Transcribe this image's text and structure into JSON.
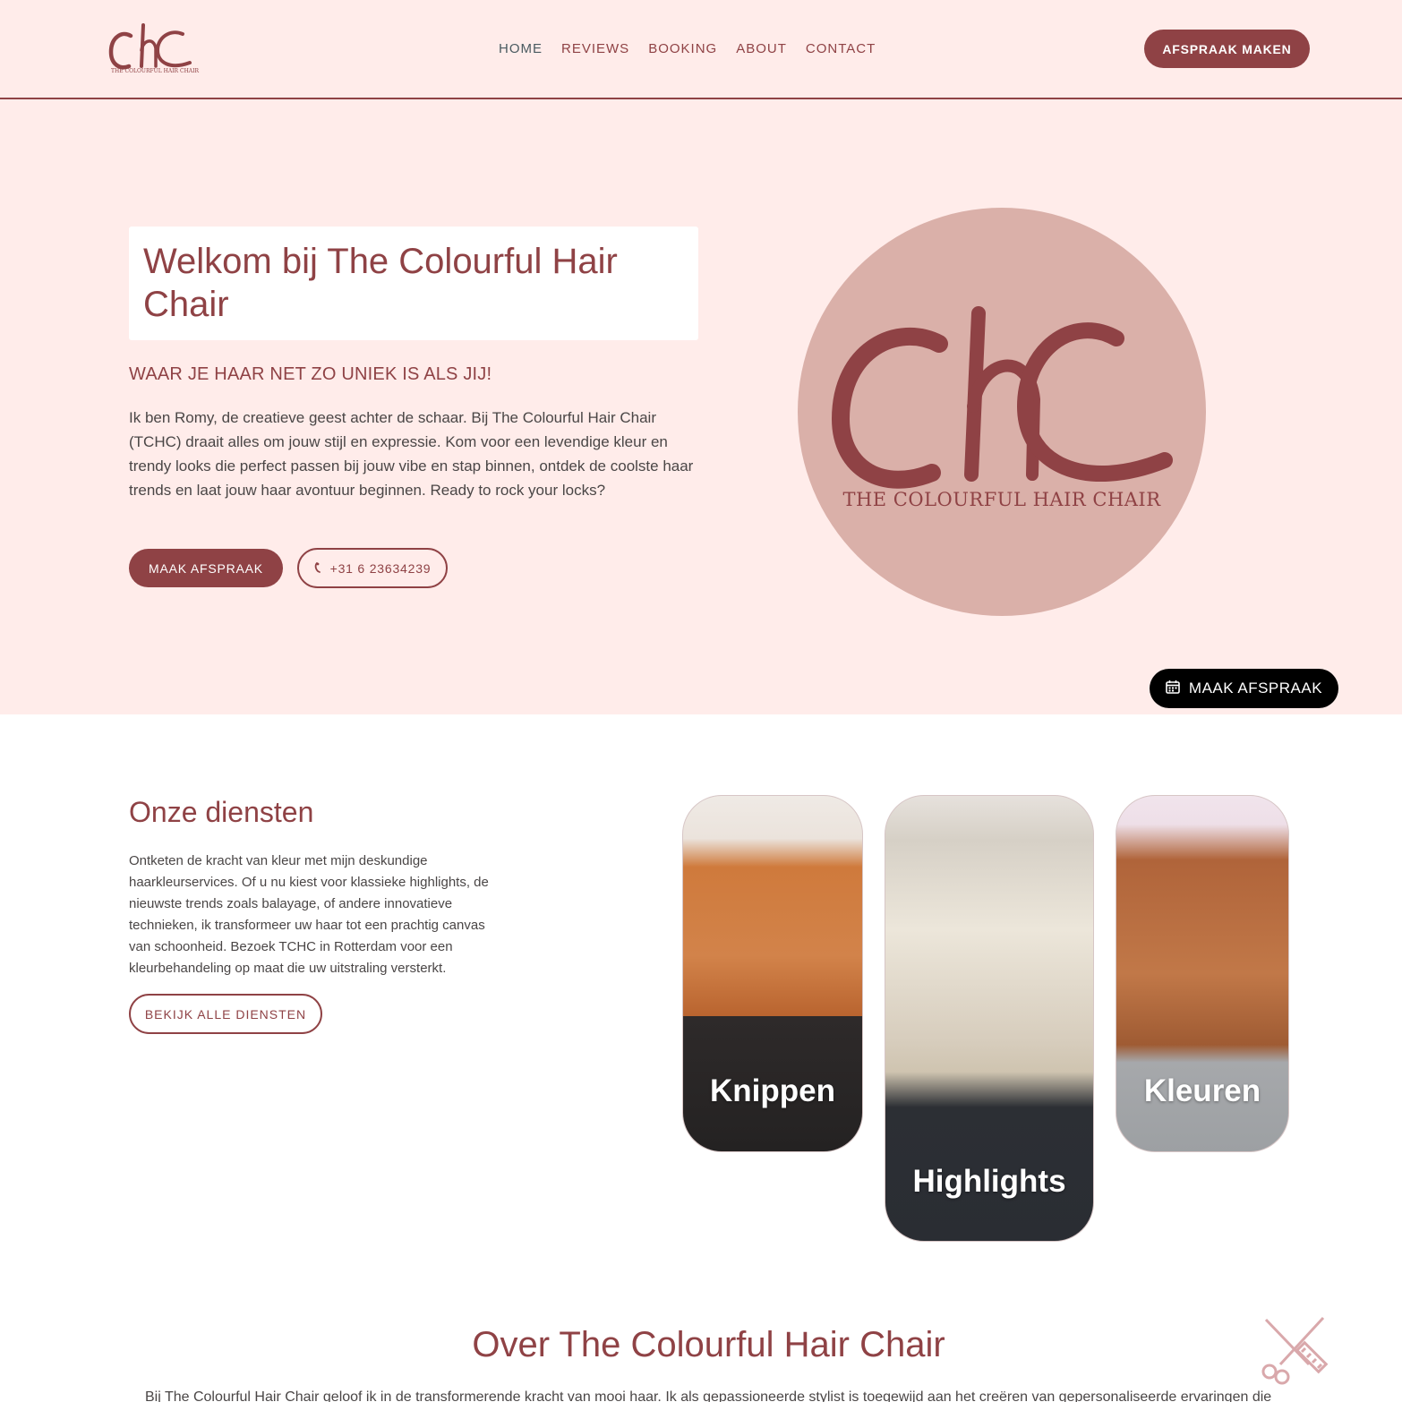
{
  "header": {
    "logo_alt": "CHC",
    "logo_subtext": "THE COLOURFUL HAIR CHAIR",
    "nav": [
      {
        "label": "HOME",
        "active": true
      },
      {
        "label": "REVIEWS",
        "active": false
      },
      {
        "label": "BOOKING",
        "active": false
      },
      {
        "label": "ABOUT",
        "active": false
      },
      {
        "label": "CONTACT",
        "active": false
      }
    ],
    "cta_label": "AFSPRAAK MAKEN"
  },
  "hero": {
    "title": "Welkom bij The Colourful Hair Chair",
    "subtitle": "WAAR JE HAAR NET ZO UNIEK IS ALS JIJ!",
    "intro": "Ik ben Romy, de creatieve geest achter de schaar. Bij The Colourful Hair Chair (TCHC) draait alles om jouw stijl en expressie. Kom voor een levendige kleur en trendy looks die perfect passen bij jouw vibe en stap binnen, ontdek de coolste haar trends en laat jouw haar avontuur beginnen. Ready to rock your locks?",
    "primary_button": "MAAK AFSPRAAK",
    "phone_button": "+31 6 23634239",
    "phone_icon": "phone-icon",
    "circle_caption": "THE COLOURFUL HAIR CHAIR"
  },
  "floating_button": {
    "label": "MAAK AFSPRAAK",
    "icon": "calendar-icon"
  },
  "services": {
    "title": "Onze diensten",
    "text": "Ontketen de kracht van kleur met mijn deskundige haarkleurservices. Of u nu kiest voor klassieke highlights, de nieuwste trends zoals balayage, of andere innovatieve technieken, ik transformeer uw haar tot een prachtig canvas van schoonheid. Bezoek TCHC in Rotterdam voor een kleurbehandeling op maat die uw uitstraling versterkt.",
    "button": "BEKIJK ALLE DIENSTEN",
    "cards": [
      {
        "label": "Knippen"
      },
      {
        "label": "Highlights"
      },
      {
        "label": "Kleuren"
      }
    ]
  },
  "about": {
    "title": "Over The Colourful Hair Chair",
    "text": "Bij The Colourful Hair Chair geloof ik in de transformerende kracht van mooi haar. Ik als gepassioneerde stylist is toegewijd aan het creëren van gepersonaliseerde ervaringen die",
    "decor_icon": "scissors-comb-icon"
  },
  "colors": {
    "brand": "#8f4245",
    "hero_bg": "#ffecea",
    "circle_bg": "#dab0a9",
    "float_button_bg": "#000000"
  }
}
